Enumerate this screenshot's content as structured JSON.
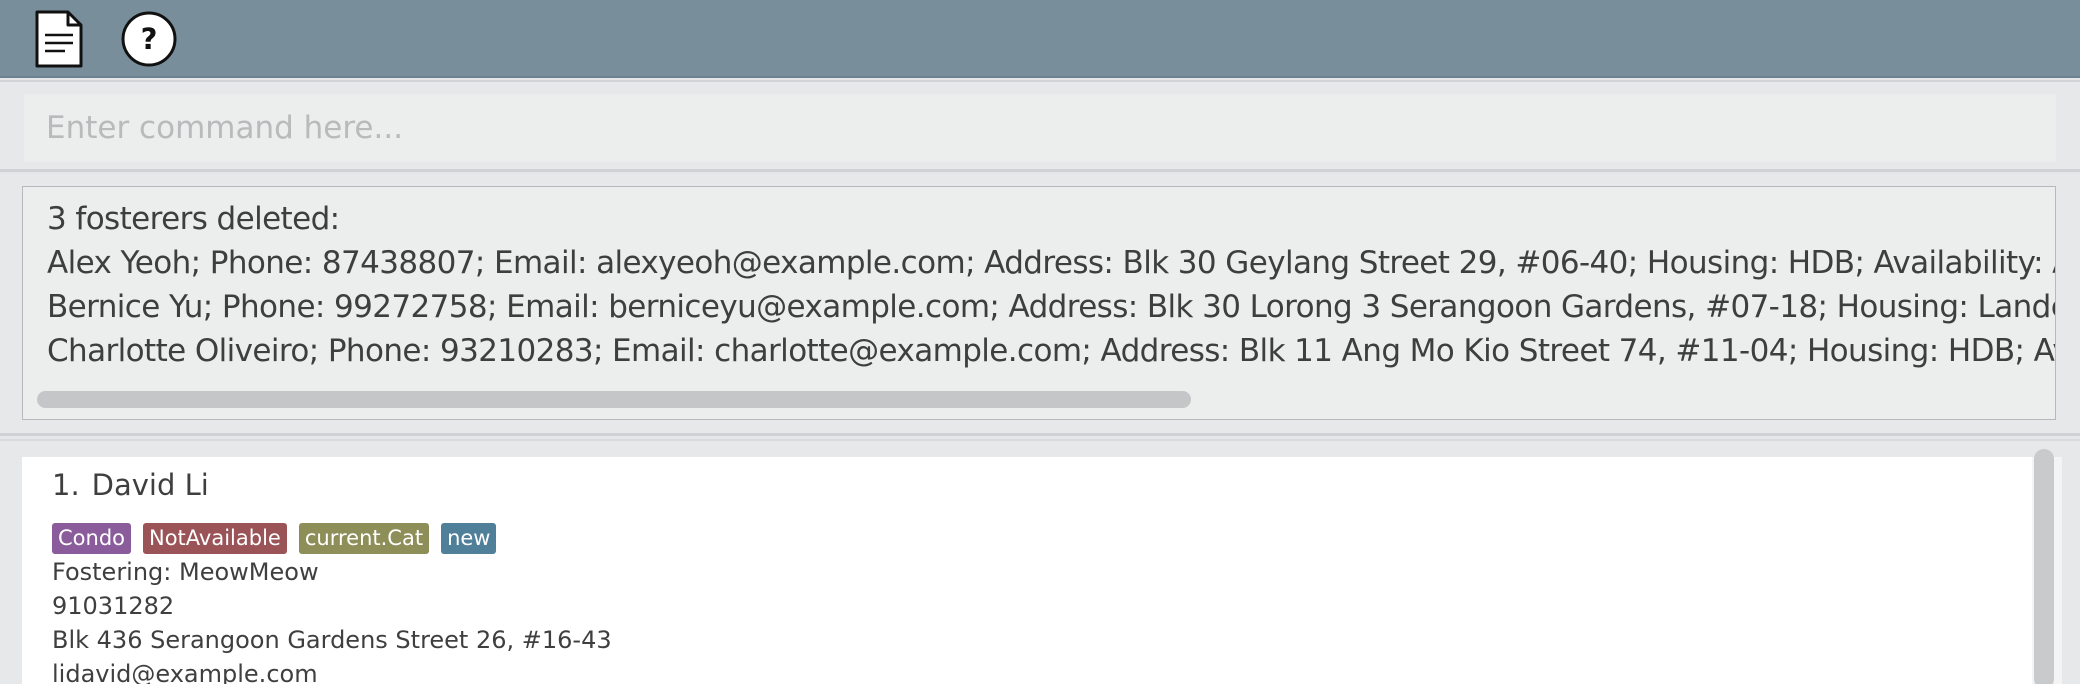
{
  "toolbar": {
    "buttons": [
      {
        "icon": "document-icon"
      },
      {
        "icon": "help-icon",
        "glyph": "?"
      }
    ]
  },
  "command": {
    "placeholder": "Enter command here...",
    "value": ""
  },
  "result": {
    "lines": [
      "3 fosterers deleted:",
      "Alex Yeoh; Phone: 87438807; Email: alexyeoh@example.com; Address: Blk 30 Geylang Street 29, #06-40; Housing: HDB; Availability: Avai",
      "Bernice Yu; Phone: 99272758; Email: berniceyu@example.com; Address: Blk 30 Lorong 3 Serangoon Gardens, #07-18; Housing: Landed; A",
      "Charlotte Oliveiro; Phone: 93210283; Email: charlotte@example.com; Address: Blk 11 Ang Mo Kio Street 74, #11-04; Housing: HDB; Availab"
    ]
  },
  "list": {
    "persons": [
      {
        "index": "1.",
        "name": "David Li",
        "tags": [
          {
            "label": "Condo",
            "color": "#8a5c9b"
          },
          {
            "label": "NotAvailable",
            "color": "#9a5458"
          },
          {
            "label": "current.Cat",
            "color": "#8e8e58"
          },
          {
            "label": "new",
            "color": "#4f7f99"
          }
        ],
        "fostering": "Fostering: MeowMeow",
        "phone": "91031282",
        "address": "Blk 436 Serangoon Gardens Street 26, #16-43",
        "email": "lidavid@example.com"
      }
    ]
  },
  "colors": {
    "toolbar": "#788f9b",
    "panel": "#e7e8e9",
    "field": "#eceded",
    "text": "#3f3f3f"
  }
}
